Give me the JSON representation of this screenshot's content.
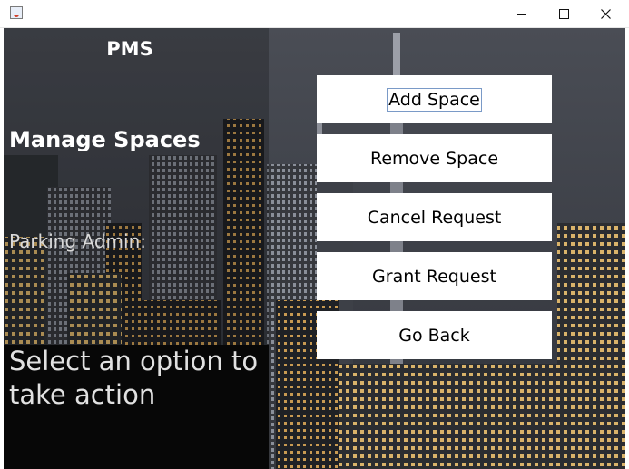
{
  "window": {
    "controls": {
      "minimize_icon": "minimize-icon",
      "maximize_icon": "maximize-icon",
      "close_icon": "close-icon"
    }
  },
  "sidebar": {
    "app_name": "PMS",
    "heading": "Manage Spaces",
    "subtitle": "Parking Admin:",
    "instruction": "Select an option to take action"
  },
  "actions": [
    {
      "label": "Add Space",
      "focused": true
    },
    {
      "label": "Remove Space"
    },
    {
      "label": "Cancel Request"
    },
    {
      "label": "Grant Request"
    },
    {
      "label": "Go Back"
    }
  ],
  "colors": {
    "button_bg": "#ffffff",
    "panel_dark": "#070707",
    "sky": "#3e4148"
  }
}
